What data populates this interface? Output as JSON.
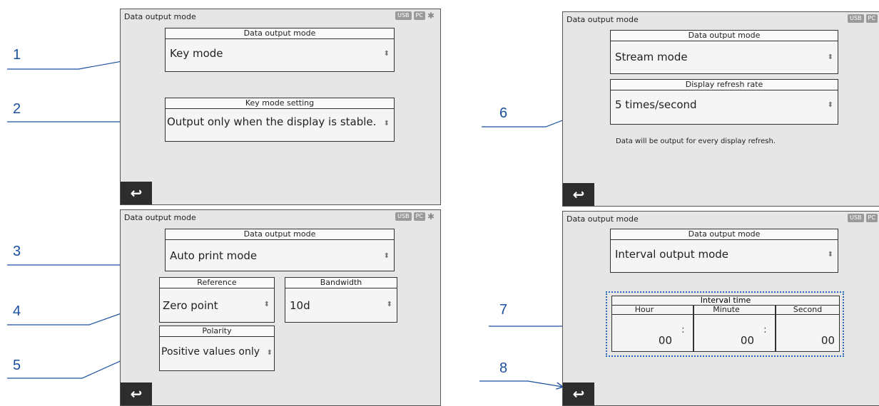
{
  "callouts": [
    "1",
    "2",
    "3",
    "4",
    "5",
    "6",
    "7",
    "8"
  ],
  "screen_title": "Data output mode",
  "status": {
    "usb": "USB",
    "pc": "PC",
    "bt": "✱"
  },
  "back_glyph": "↩",
  "s1": {
    "mode_header": "Data output mode",
    "mode_value": "Key mode",
    "setting_header": "Key mode setting",
    "setting_value": "Output only when the display is stable."
  },
  "s2": {
    "mode_header": "Data output mode",
    "mode_value": "Auto print mode",
    "reference_header": "Reference",
    "reference_value": "Zero point",
    "bandwidth_header": "Bandwidth",
    "bandwidth_value": "10d",
    "polarity_header": "Polarity",
    "polarity_value": "Positive values only"
  },
  "s3": {
    "mode_header": "Data output mode",
    "mode_value": "Stream mode",
    "rate_header": "Display refresh rate",
    "rate_value": "5 times/second",
    "hint": "Data will be output  for every display refresh."
  },
  "s4": {
    "mode_header": "Data output mode",
    "mode_value": "Interval output mode",
    "interval_header": "Interval time",
    "hour_header": "Hour",
    "hour_value": "00",
    "minute_header": "Minute",
    "minute_value": "00",
    "second_header": "Second",
    "second_value": "00",
    "colon": ":"
  },
  "spinner_glyph": "⬍",
  "colors": {
    "callout": "#1a4fa0",
    "dotted_box": "#2a6ab5"
  }
}
